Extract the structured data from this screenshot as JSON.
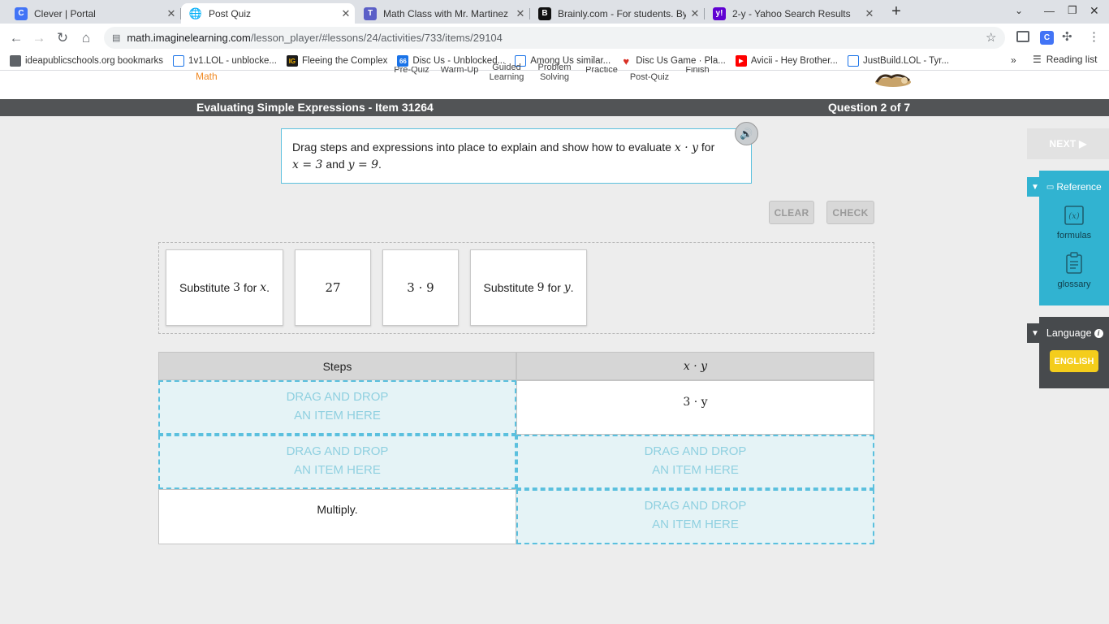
{
  "browser": {
    "tabs": [
      {
        "title": "Clever | Portal",
        "icon": "clever-icon",
        "color": "#4274f6"
      },
      {
        "title": "Post Quiz",
        "icon": "globe-icon",
        "color": "#5f6368"
      },
      {
        "title": "Math Class with Mr. Martinez (6",
        "icon": "teams-icon",
        "color": "#5b5fc7"
      },
      {
        "title": "Brainly.com - For students. By st",
        "icon": "brainly-icon",
        "color": "#111111"
      },
      {
        "title": "2-y - Yahoo Search Results",
        "icon": "yahoo-icon",
        "color": "#6001d2"
      }
    ],
    "url_host": "math.imaginelearning.com",
    "url_path": "/lesson_player/#lessons/24/activities/733/items/29104",
    "bookmarks": [
      {
        "label": "ideapublicschools.org bookmarks",
        "icon": "folder-icon"
      },
      {
        "label": "1v1.LOL - unblocke...",
        "icon": "page-icon"
      },
      {
        "label": "Fleeing the Complex",
        "icon": "game-icon"
      },
      {
        "label": "Disc Us - Unblocked...",
        "icon": "page-icon"
      },
      {
        "label": "Among Us similar...",
        "icon": "page-icon"
      },
      {
        "label": "Disc Us Game · Pla...",
        "icon": "heart-icon"
      },
      {
        "label": "Avicii - Hey Brother...",
        "icon": "youtube-icon"
      },
      {
        "label": "JustBuild.LOL - Tyr...",
        "icon": "page-icon"
      }
    ],
    "reading_list": "Reading list"
  },
  "app": {
    "header_nav": {
      "brand": "Math",
      "pre_quiz": "Pre-Quiz",
      "warm_up": "Warm-Up",
      "guided_learning": "Guided Learning",
      "problem_solving": "Problem Solving",
      "practice": "Practice",
      "post_quiz": "Post-Quiz",
      "finish": "Finish"
    },
    "title": "Evaluating Simple Expressions - Item 31264",
    "question_counter": "Question 2 of 7",
    "prompt": {
      "text_start": "Drag steps and expressions into place to explain and show how to evaluate ",
      "expr": "x · y",
      "for_word": " for",
      "x_eq": "x = 3",
      "and_word": " and ",
      "y_eq": "y = 9",
      "end": "."
    },
    "buttons": {
      "clear": "CLEAR",
      "check": "CHECK",
      "next": "NEXT ▶"
    },
    "tiles": [
      {
        "pre": "Substitute ",
        "num": "3",
        "mid": " for ",
        "var": "x",
        "post": "."
      },
      {
        "value": "27"
      },
      {
        "value": "3 · 9"
      },
      {
        "pre": "Substitute ",
        "num": "9",
        "mid": " for ",
        "var": "y",
        "post": "."
      }
    ],
    "table": {
      "col_steps": "Steps",
      "col_expr": "x · y",
      "drop_line1": "DRAG AND DROP",
      "drop_line2": "AN ITEM HERE",
      "row1_expr": "3 · y",
      "row3_step": "Multiply."
    },
    "reference": {
      "title": "Reference",
      "formulas": "formulas",
      "glossary": "glossary",
      "color": "#31b3d1"
    },
    "language": {
      "title": "Language",
      "english": "ENGLISH",
      "accent": "#f4cd1c"
    }
  }
}
